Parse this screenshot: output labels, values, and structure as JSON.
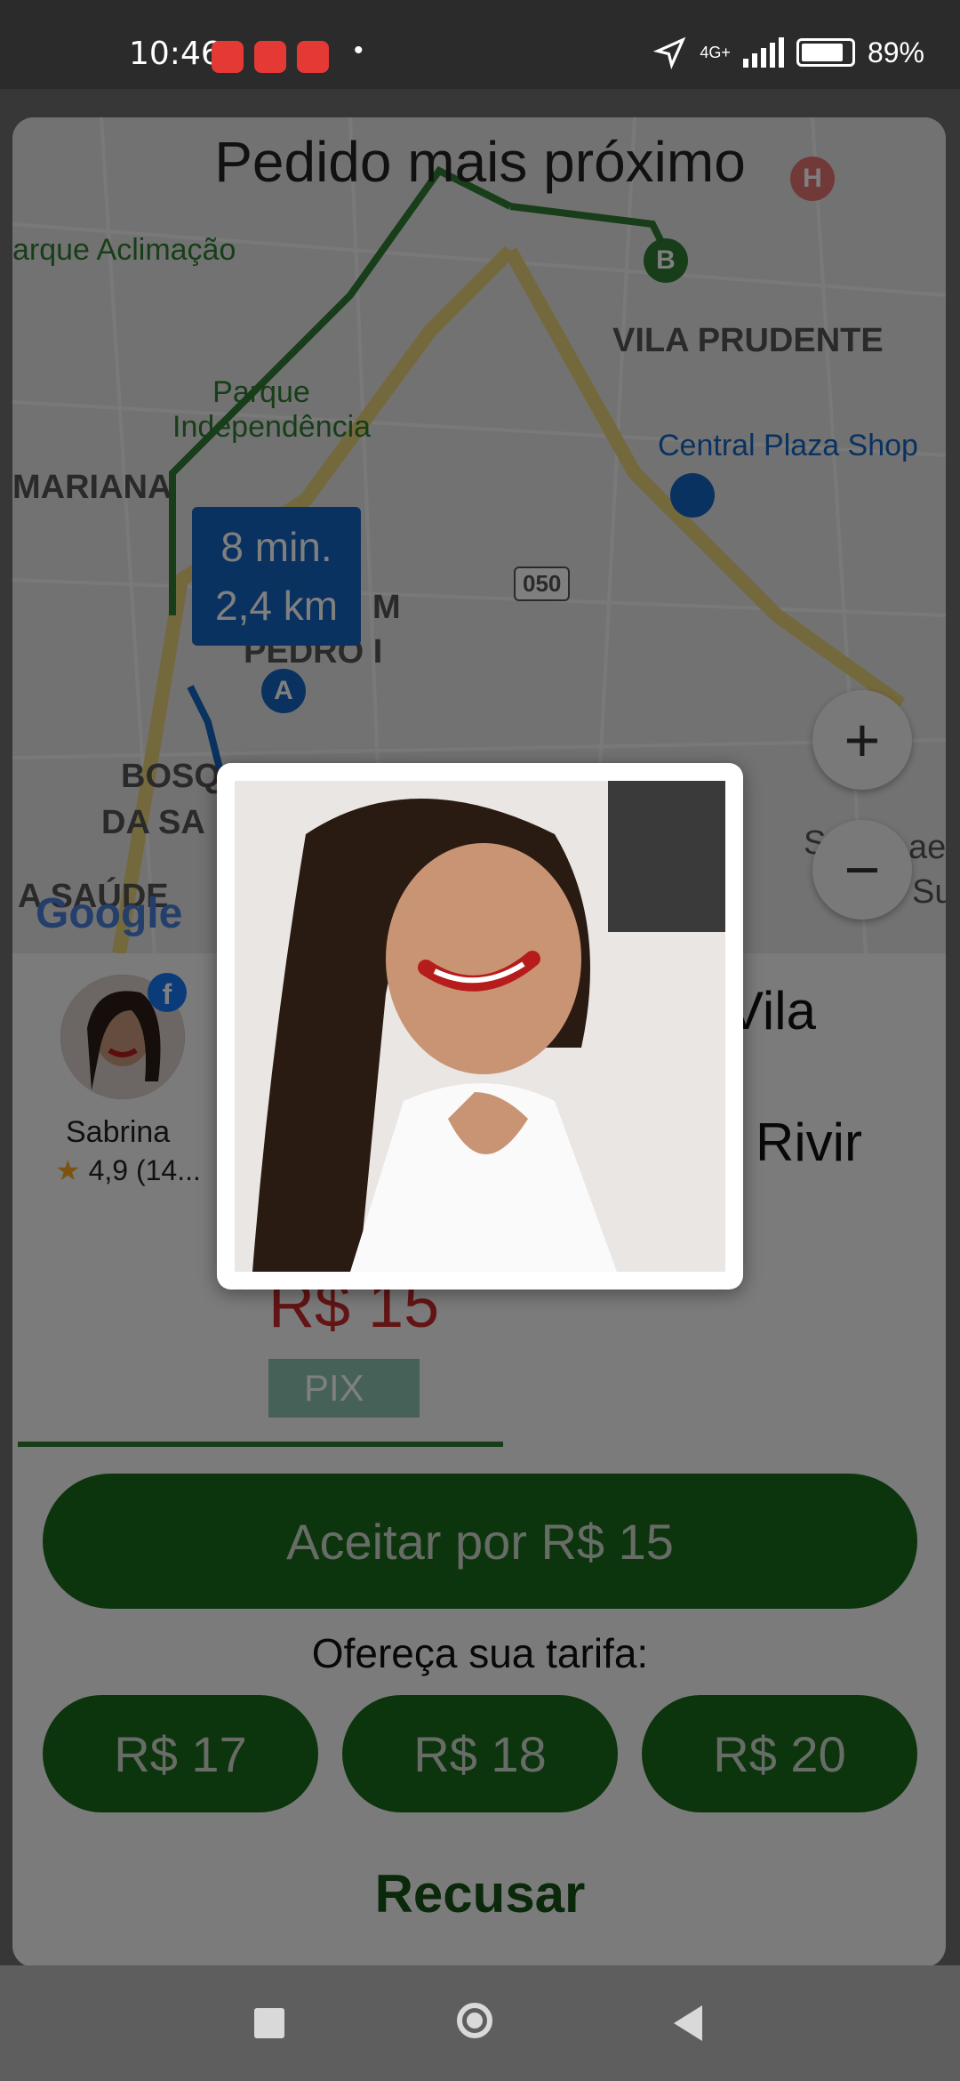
{
  "status_bar": {
    "time": "10:46",
    "network": "4G+",
    "battery": "89%",
    "dot": "•"
  },
  "header": {
    "title": "Pedido mais próximo"
  },
  "map": {
    "labels": [
      "arque Aclimação",
      "VILA PRUDENTE",
      "Parque Independência",
      "Central Plaza Shop",
      "MARIANA",
      "050",
      "M",
      "PEDRO I",
      "BOSQ",
      "DA SA",
      "A SAÚDE",
      "S",
      "Su",
      "ae"
    ],
    "route_tag": {
      "time": "8 min.",
      "distance": "2,4 km"
    },
    "pins": [
      "A",
      "B",
      "H"
    ],
    "zoom": {
      "in": "+",
      "out": "−"
    },
    "attribution": "Google"
  },
  "driver": {
    "name": "Sabrina",
    "rating": "4,9 (14..."
  },
  "ride": {
    "destination_snippet_1": "Vila",
    "destination_snippet_2": "Rivir",
    "price": "R$ 15",
    "payment": "PIX"
  },
  "actions": {
    "accept": "Aceitar por R$ 15",
    "offer_label": "Ofereça sua tarifa:",
    "offers": [
      "R$ 17",
      "R$ 18",
      "R$ 20"
    ],
    "decline": "Recusar"
  },
  "colors": {
    "accent": "#1b6b1b",
    "price": "#c62828",
    "route": "#1565c0",
    "pix": "#8bc3b0"
  }
}
